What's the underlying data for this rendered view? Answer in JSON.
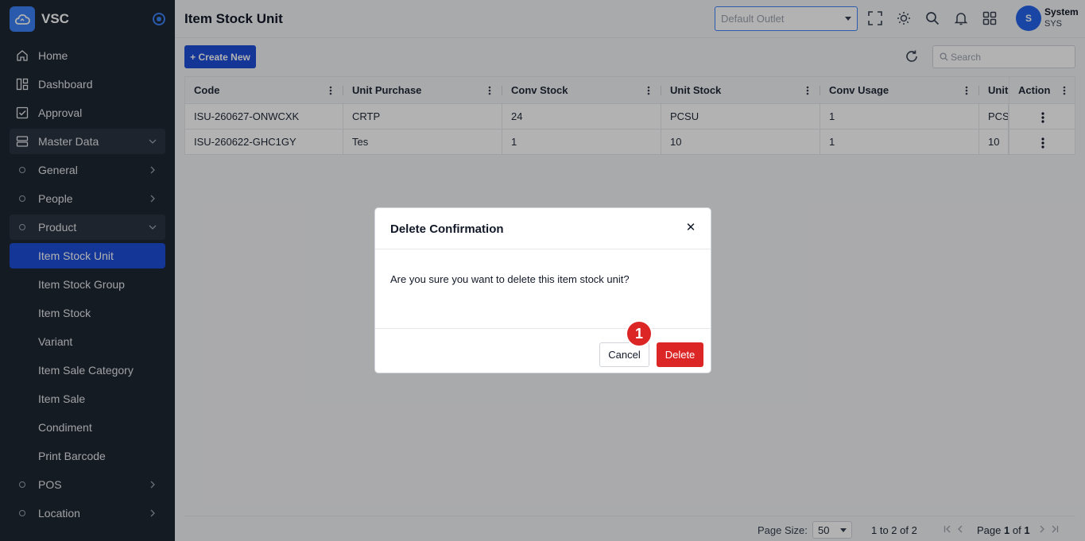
{
  "app": {
    "name": "VSC"
  },
  "sidebar": {
    "items": [
      {
        "label": "Home",
        "icon": "home-icon"
      },
      {
        "label": "Dashboard",
        "icon": "dashboard-icon"
      },
      {
        "label": "Approval",
        "icon": "approval-icon"
      },
      {
        "label": "Master Data",
        "icon": "database-icon"
      },
      {
        "label": "General"
      },
      {
        "label": "People"
      },
      {
        "label": "Product"
      },
      {
        "label": "Item Stock Unit"
      },
      {
        "label": "Item Stock Group"
      },
      {
        "label": "Item Stock"
      },
      {
        "label": "Variant"
      },
      {
        "label": "Item Sale Category"
      },
      {
        "label": "Item Sale"
      },
      {
        "label": "Condiment"
      },
      {
        "label": "Print Barcode"
      },
      {
        "label": "POS"
      },
      {
        "label": "Location"
      }
    ]
  },
  "header": {
    "title": "Item Stock Unit",
    "outlet_placeholder": "Default Outlet",
    "user": {
      "initial": "S",
      "name": "System",
      "code": "SYS"
    }
  },
  "toolbar": {
    "create_label": "+ Create New",
    "search_placeholder": "Search"
  },
  "table": {
    "columns": [
      "Code",
      "Unit Purchase",
      "Conv Stock",
      "Unit Stock",
      "Conv Usage",
      "Unit",
      "Action"
    ],
    "rows": [
      {
        "code": "ISU-260627-ONWCXK",
        "unit_purchase": "CRTP",
        "conv_stock": "24",
        "unit_stock": "PCSU",
        "conv_usage": "1",
        "unit": "PCS"
      },
      {
        "code": "ISU-260622-GHC1GY",
        "unit_purchase": "Tes",
        "conv_stock": "1",
        "unit_stock": "10",
        "conv_usage": "1",
        "unit": "10"
      }
    ]
  },
  "pagination": {
    "page_size_label": "Page Size:",
    "page_size": "50",
    "range_text": "1 to 2 of 2",
    "page_prefix": "Page",
    "page": "1",
    "of_label": "of",
    "total_pages": "1"
  },
  "modal": {
    "title": "Delete Confirmation",
    "message": "Are you sure you want to delete this item stock unit?",
    "cancel_label": "Cancel",
    "delete_label": "Delete",
    "step_badge": "1"
  },
  "colors": {
    "sidebar_bg": "#1f2733",
    "accent": "#1d4ed8",
    "danger": "#dc2626"
  }
}
